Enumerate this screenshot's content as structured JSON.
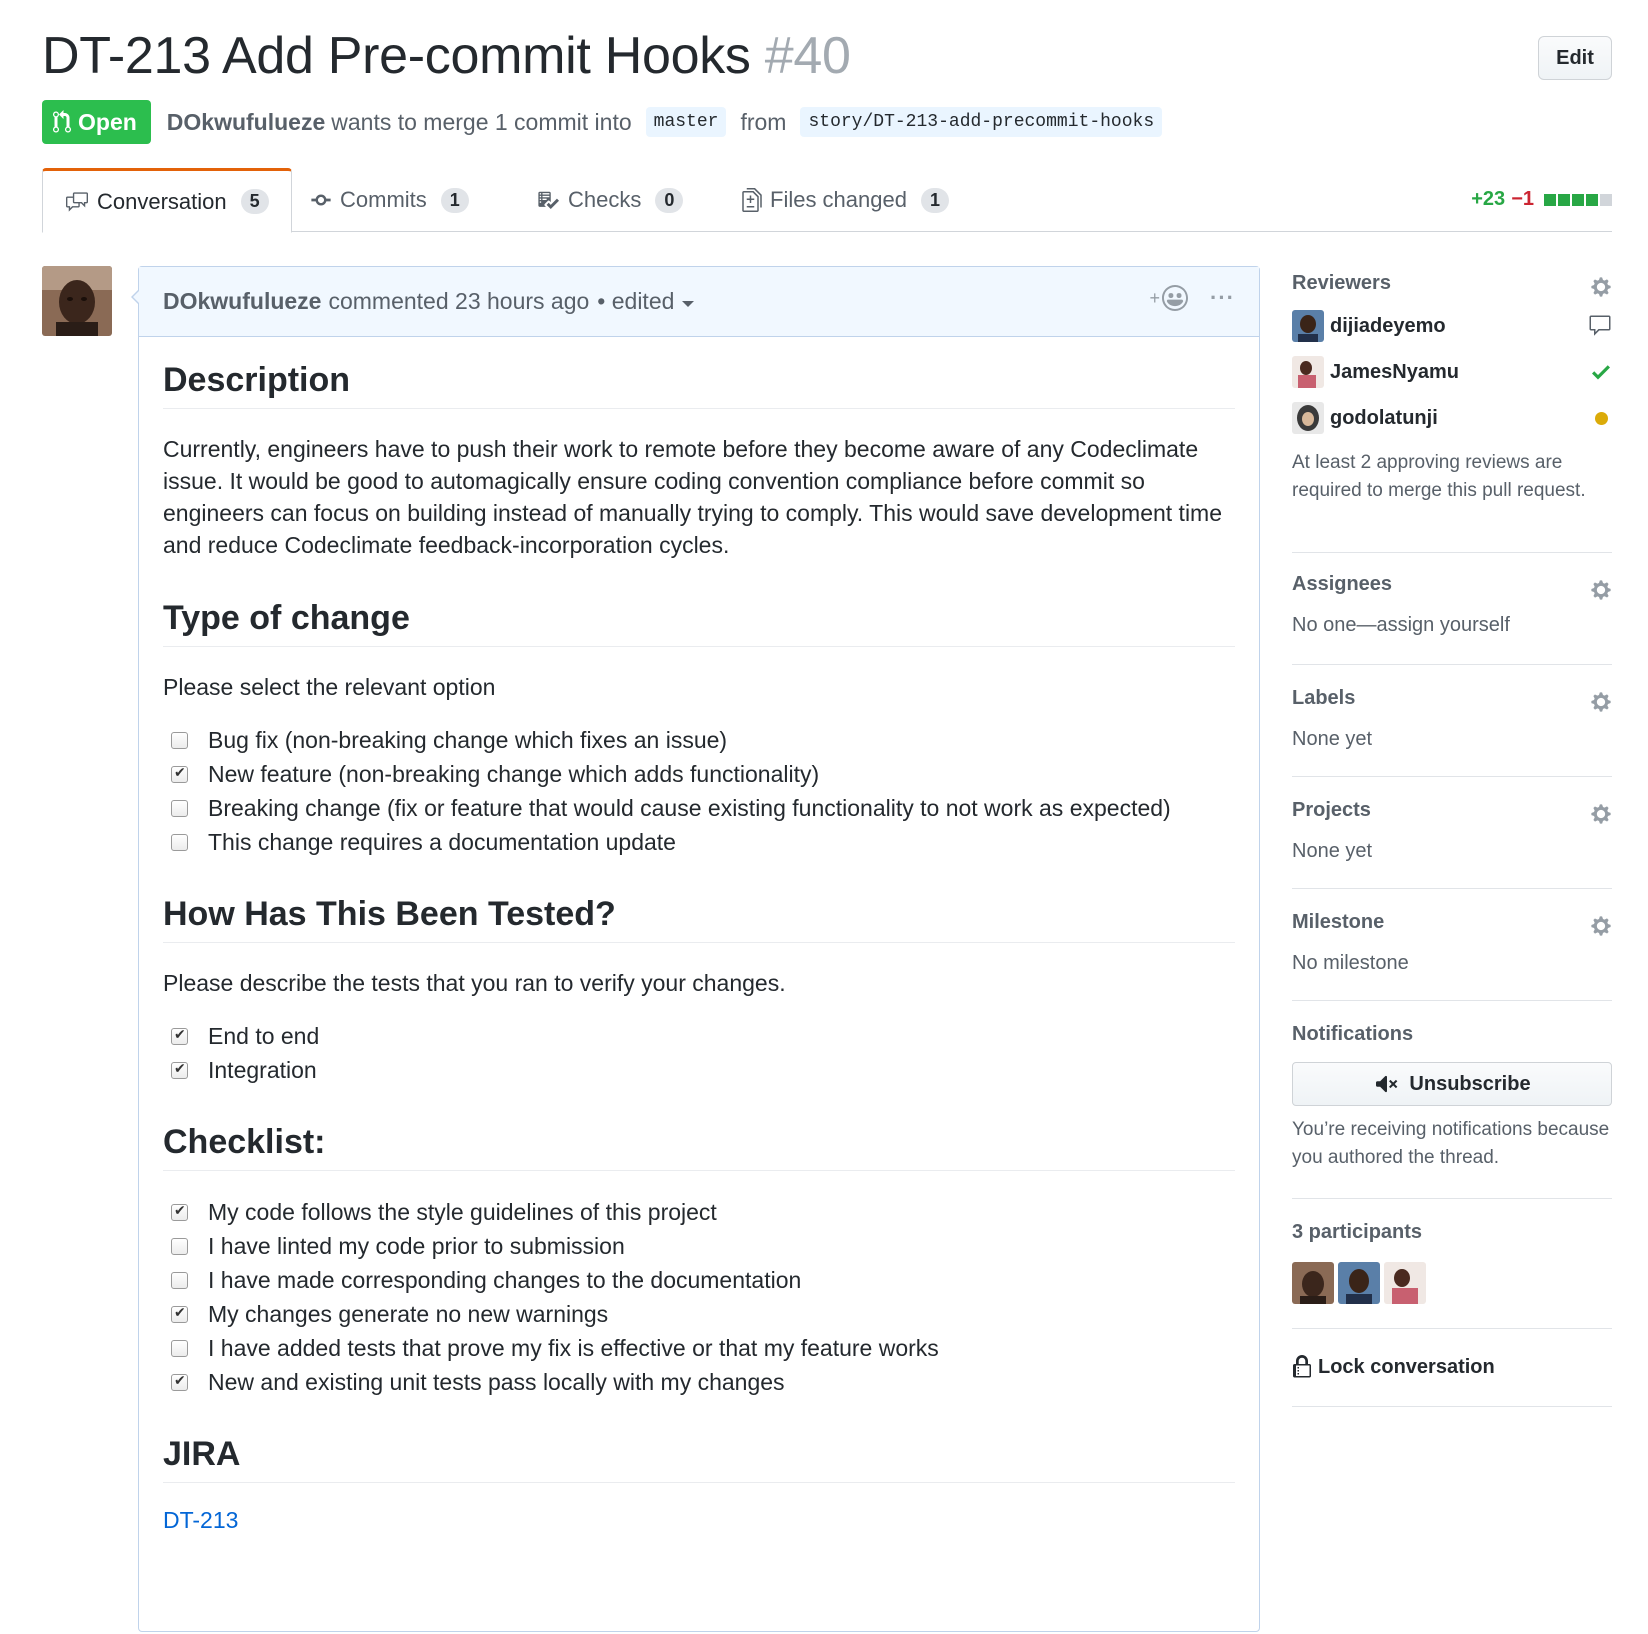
{
  "pr": {
    "title": "DT-213 Add Pre-commit Hooks",
    "number": "#40",
    "edit_label": "Edit",
    "state": "Open",
    "author": "DOkwufulueze",
    "merge_text": "wants to merge 1 commit into",
    "base_branch": "master",
    "from_text": "from",
    "head_branch": "story/DT-213-add-precommit-hooks"
  },
  "tabs": [
    {
      "label": "Conversation",
      "count": "5",
      "icon": "comment-discussion-icon"
    },
    {
      "label": "Commits",
      "count": "1",
      "icon": "git-commit-icon"
    },
    {
      "label": "Checks",
      "count": "0",
      "icon": "checklist-icon"
    },
    {
      "label": "Files changed",
      "count": "1",
      "icon": "file-diff-icon"
    }
  ],
  "diffstat": {
    "additions": "+23",
    "deletions": "−1",
    "colors": [
      "#28a745",
      "#28a745",
      "#28a745",
      "#28a745",
      "#d1d5da"
    ]
  },
  "comment": {
    "author": "DOkwufulueze",
    "meta": "commented 23 hours ago",
    "edited": "• edited"
  },
  "body": {
    "description_heading": "Description",
    "description_text": "Currently, engineers have to push their work to remote before they become aware of any Codeclimate issue. It would be good to automagically ensure coding convention compliance before commit so engineers can focus on building instead of manually trying to comply. This would save development time and reduce Codeclimate feedback-incorporation cycles.",
    "type_heading": "Type of change",
    "type_intro": "Please select the relevant option",
    "type_options": [
      {
        "label": "Bug fix (non-breaking change which fixes an issue)",
        "checked": false
      },
      {
        "label": "New feature (non-breaking change which adds functionality)",
        "checked": true
      },
      {
        "label": "Breaking change (fix or feature that would cause existing functionality to not work as expected)",
        "checked": false
      },
      {
        "label": "This change requires a documentation update",
        "checked": false
      }
    ],
    "tested_heading": "How Has This Been Tested?",
    "tested_intro": "Please describe the tests that you ran to verify your changes.",
    "tested_options": [
      {
        "label": "End to end",
        "checked": true
      },
      {
        "label": "Integration",
        "checked": true
      }
    ],
    "checklist_heading": "Checklist:",
    "checklist_options": [
      {
        "label": "My code follows the style guidelines of this project",
        "checked": true
      },
      {
        "label": "I have linted my code prior to submission",
        "checked": false
      },
      {
        "label": "I have made corresponding changes to the documentation",
        "checked": false
      },
      {
        "label": "My changes generate no new warnings",
        "checked": true
      },
      {
        "label": "I have added tests that prove my fix is effective or that my feature works",
        "checked": false
      },
      {
        "label": "New and existing unit tests pass locally with my changes",
        "checked": true
      }
    ],
    "jira_heading": "JIRA",
    "jira_link": "DT-213"
  },
  "sidebar": {
    "reviewers_heading": "Reviewers",
    "reviewers": [
      {
        "name": "dijiadeyemo",
        "status": "commented",
        "status_icon": "comment-icon"
      },
      {
        "name": "JamesNyamu",
        "status": "approved",
        "status_icon": "check-icon"
      },
      {
        "name": "godolatunji",
        "status": "pending",
        "status_icon": "pending-dot-icon"
      }
    ],
    "reviewers_note": "At least 2 approving reviews are required to merge this pull request.",
    "assignees_heading": "Assignees",
    "assignees_value": "No one—assign yourself",
    "labels_heading": "Labels",
    "labels_value": "None yet",
    "projects_heading": "Projects",
    "projects_value": "None yet",
    "milestone_heading": "Milestone",
    "milestone_value": "No milestone",
    "notifications_heading": "Notifications",
    "unsubscribe_label": "Unsubscribe",
    "notifications_note": "You’re receiving notifications because you authored the thread.",
    "participants_heading": "3 participants",
    "lock_label": "Lock conversation"
  },
  "colors": {
    "open_green": "#2cbe4e",
    "link_blue": "#0366d6",
    "approve_green": "#28a745",
    "pending_yellow": "#dbab09",
    "tab_accent": "#e36209"
  }
}
